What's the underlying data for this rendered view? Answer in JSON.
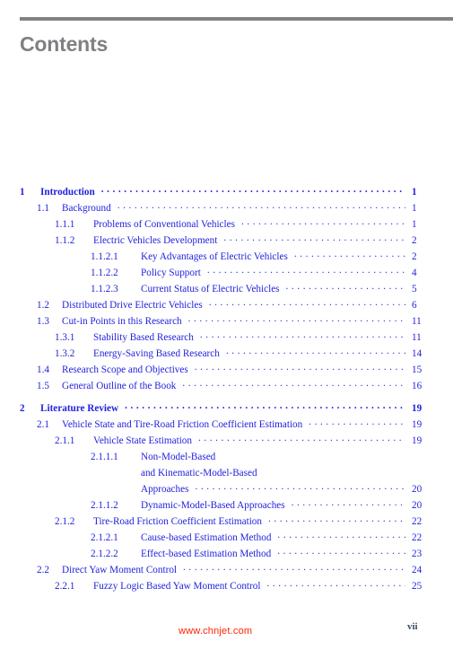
{
  "header": {
    "title": "Contents"
  },
  "footer": {
    "watermark": "www.chnjet.com",
    "page_number": "vii"
  },
  "colors": {
    "entry_blue": "#2222dd",
    "title_grey": "#7f8083",
    "rule_grey": "#808285",
    "watermark_red": "#ff2200",
    "folio_grey": "#3a4a5a"
  },
  "toc": {
    "entries": [
      {
        "level": 0,
        "number": "1",
        "label": "Introduction",
        "page": "1",
        "leader": true,
        "gap_before": false
      },
      {
        "level": 1,
        "number": "1.1",
        "label": "Background",
        "page": "1",
        "leader": true,
        "gap_before": false
      },
      {
        "level": 2,
        "number": "1.1.1",
        "label": "Problems of Conventional Vehicles",
        "page": "1",
        "leader": true,
        "gap_before": false
      },
      {
        "level": 2,
        "number": "1.1.2",
        "label": "Electric Vehicles Development",
        "page": "2",
        "leader": true,
        "gap_before": false
      },
      {
        "level": 3,
        "number": "1.1.2.1",
        "label": "Key Advantages of Electric Vehicles",
        "page": "2",
        "leader": true,
        "gap_before": false
      },
      {
        "level": 3,
        "number": "1.1.2.2",
        "label": "Policy Support",
        "page": "4",
        "leader": true,
        "gap_before": false
      },
      {
        "level": 3,
        "number": "1.1.2.3",
        "label": "Current Status of Electric Vehicles",
        "page": "5",
        "leader": true,
        "gap_before": false
      },
      {
        "level": 1,
        "number": "1.2",
        "label": "Distributed Drive Electric Vehicles",
        "page": "6",
        "leader": true,
        "gap_before": false
      },
      {
        "level": 1,
        "number": "1.3",
        "label": "Cut-in Points in this Research",
        "page": "11",
        "leader": true,
        "gap_before": false
      },
      {
        "level": 2,
        "number": "1.3.1",
        "label": "Stability Based Research",
        "page": "11",
        "leader": true,
        "gap_before": false
      },
      {
        "level": 2,
        "number": "1.3.2",
        "label": "Energy-Saving Based Research",
        "page": "14",
        "leader": true,
        "gap_before": false
      },
      {
        "level": 1,
        "number": "1.4",
        "label": "Research Scope and Objectives",
        "page": "15",
        "leader": true,
        "gap_before": false
      },
      {
        "level": 1,
        "number": "1.5",
        "label": "General Outline of the Book",
        "page": "16",
        "leader": true,
        "gap_before": false
      },
      {
        "level": 0,
        "number": "2",
        "label": "Literature Review",
        "page": "19",
        "leader": true,
        "gap_before": true
      },
      {
        "level": 1,
        "number": "2.1",
        "label": "Vehicle State and Tire-Road Friction Coefficient Estimation",
        "page": "19",
        "leader": true,
        "gap_before": false
      },
      {
        "level": 2,
        "number": "2.1.1",
        "label": "Vehicle State Estimation",
        "page": "19",
        "leader": true,
        "gap_before": false
      },
      {
        "level": 3,
        "number": "2.1.1.1",
        "label": "Non-Model-Based",
        "page": "",
        "leader": false,
        "gap_before": false
      },
      {
        "level": 3,
        "number": "",
        "label": "and  Kinematic-Model-Based",
        "page": "",
        "leader": false,
        "gap_before": false,
        "continuation": true
      },
      {
        "level": 3,
        "number": "",
        "label": "Approaches",
        "page": "20",
        "leader": true,
        "gap_before": false,
        "continuation": true
      },
      {
        "level": 3,
        "number": "2.1.1.2",
        "label": "Dynamic-Model-Based Approaches",
        "page": "20",
        "leader": true,
        "gap_before": false
      },
      {
        "level": 2,
        "number": "2.1.2",
        "label": "Tire-Road Friction Coefficient Estimation",
        "page": "22",
        "leader": true,
        "gap_before": false
      },
      {
        "level": 3,
        "number": "2.1.2.1",
        "label": "Cause-based Estimation Method",
        "page": "22",
        "leader": true,
        "gap_before": false
      },
      {
        "level": 3,
        "number": "2.1.2.2",
        "label": "Effect-based Estimation Method",
        "page": "23",
        "leader": true,
        "gap_before": false
      },
      {
        "level": 1,
        "number": "2.2",
        "label": "Direct Yaw Moment Control",
        "page": "24",
        "leader": true,
        "gap_before": false
      },
      {
        "level": 2,
        "number": "2.2.1",
        "label": "Fuzzy Logic Based Yaw Moment Control",
        "page": "25",
        "leader": true,
        "gap_before": false
      }
    ]
  }
}
